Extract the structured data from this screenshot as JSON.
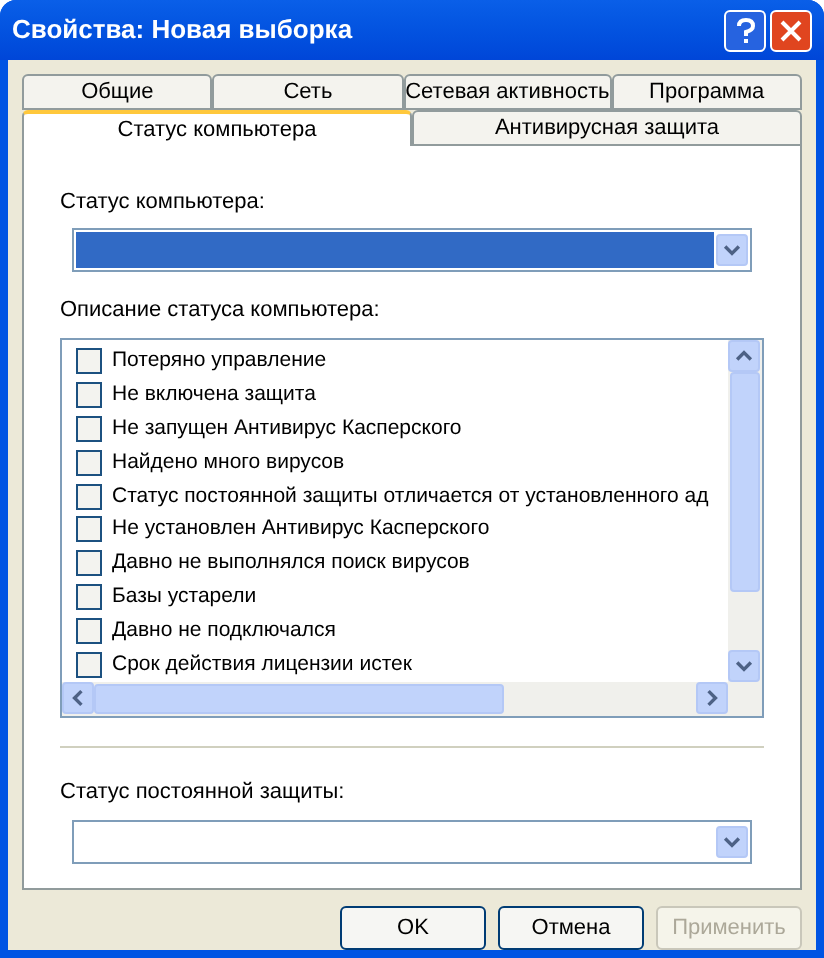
{
  "window": {
    "title": "Свойства: Новая выборка"
  },
  "tab_rows": [
    [
      {
        "label": "Общие",
        "selected": false
      },
      {
        "label": "Сеть",
        "selected": false
      },
      {
        "label": "Сетевая активность",
        "selected": false
      },
      {
        "label": "Программа",
        "selected": false
      }
    ],
    [
      {
        "label": "Статус компьютера",
        "selected": true
      },
      {
        "label": "Антивирусная защита",
        "selected": false
      }
    ]
  ],
  "computer_status": {
    "label": "Статус компьютера:",
    "focused": true
  },
  "description": {
    "label": "Описание статуса компьютера:",
    "items": [
      {
        "label": "Потеряно управление",
        "checked": false
      },
      {
        "label": "Не включена защита",
        "checked": false
      },
      {
        "label": "Не запущен Антивирус Касперского",
        "checked": false
      },
      {
        "label": "Найдено много вирусов",
        "checked": false
      },
      {
        "label": "Статус постоянной защиты отличается от установленного ад",
        "checked": false
      },
      {
        "label": "Не установлен Антивирус Касперского",
        "checked": false
      },
      {
        "label": "Давно не выполнялся поиск вирусов",
        "checked": false
      },
      {
        "label": "Базы устарели",
        "checked": false
      },
      {
        "label": "Давно не подключался",
        "checked": false
      },
      {
        "label": "Срок действия лицензии истек",
        "checked": false
      }
    ]
  },
  "protection_status": {
    "label": "Статус постоянной защиты:",
    "focused": false
  },
  "buttons": [
    {
      "label": "OK",
      "disabled": false
    },
    {
      "label": "Отмена",
      "disabled": false
    },
    {
      "label": "Применить",
      "disabled": true
    }
  ]
}
